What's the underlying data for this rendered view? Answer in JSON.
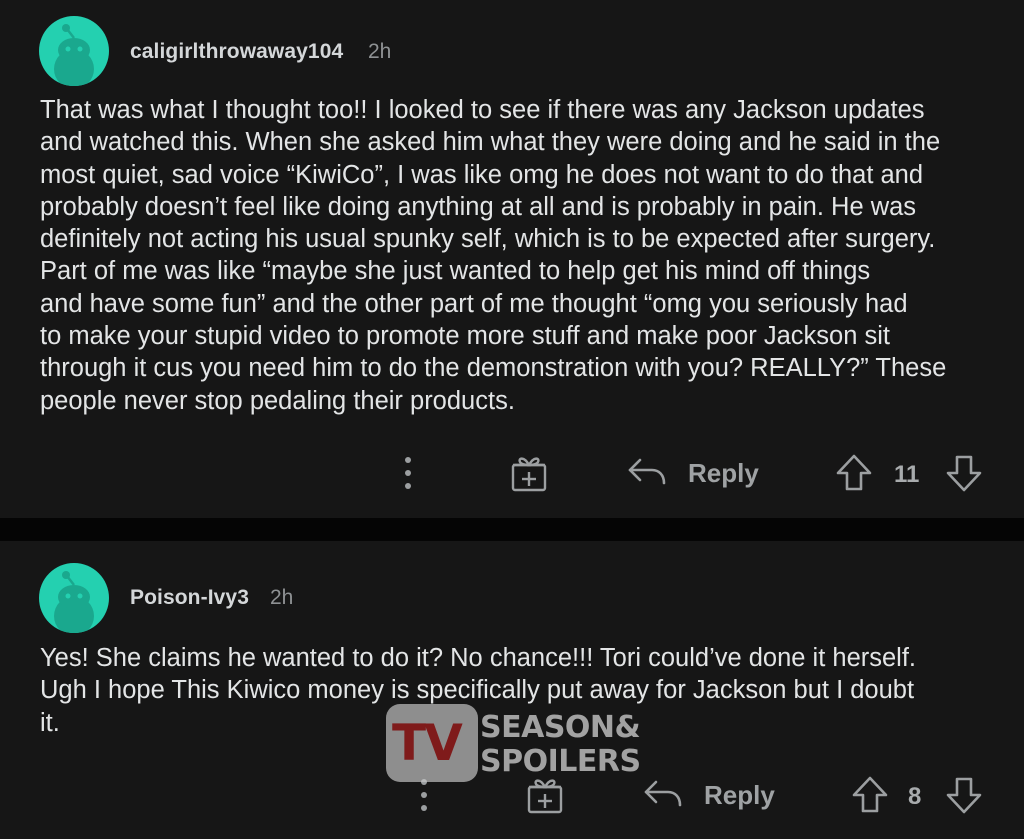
{
  "comments": [
    {
      "username": "caligirlthrowaway104",
      "time": "2h",
      "lines": [
        "That was what I thought too!! I looked to see if there was any Jackson updates",
        "and watched this. When she asked him what they were doing and he said in the",
        "most quiet, sad voice “KiwiCo”, I was like omg he does not want to do that and",
        "probably doesn’t feel like doing anything at all and is probably in pain. He was",
        "definitely not acting his usual spunky self, which is to be expected after surgery.",
        "Part of me was like “maybe she just wanted to help get his mind off things",
        "and have some fun” and the other part of me thought “omg you seriously had",
        "to make your stupid video to promote more stuff and make poor Jackson sit",
        "through it cus you need him to do the demonstration with you? REALLY?” These",
        "people never stop pedaling their products."
      ],
      "reply_label": "Reply",
      "vote_count": "11"
    },
    {
      "username": "Poison-Ivy3",
      "time": "2h",
      "lines": [
        "Yes! She claims he wanted to do it? No chance!!! Tori could’ve done it herself.",
        "Ugh I hope This Kiwico money is specifically put away for Jackson but I doubt",
        "it."
      ],
      "reply_label": "Reply",
      "vote_count": "8"
    }
  ],
  "watermark": {
    "logo_text": "TV",
    "line1": "SEASON&",
    "line2": "SPOILERS"
  },
  "icons": {
    "avatar": "snoo-avatar-icon",
    "more": "more-vertical-icon",
    "award": "award-gift-icon",
    "reply": "reply-arrow-icon",
    "upvote": "upvote-arrow-icon",
    "downvote": "downvote-arrow-icon"
  },
  "colors": {
    "background": "#161616",
    "avatar": "#24d0b0",
    "text": "#e3e5e6",
    "muted": "#8e9193"
  }
}
